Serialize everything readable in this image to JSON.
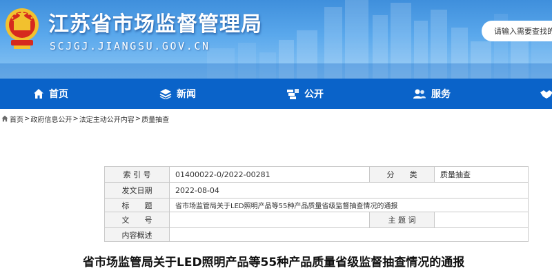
{
  "header": {
    "site_title": "江苏省市场监督管理局",
    "site_domain": "SCJGJ.JIANGSU.GOV.CN",
    "search_placeholder": "请输入需要查找的内容"
  },
  "colors": {
    "nav_background": "#0a63c9",
    "header_sky": "#5aa8ec",
    "label_cell_background": "#f3f3f3",
    "table_border": "#c9c9c9"
  },
  "nav": {
    "items": [
      {
        "label": "首页",
        "icon": "home-icon"
      },
      {
        "label": "新闻",
        "icon": "layers-icon"
      },
      {
        "label": "公开",
        "icon": "stack-icon"
      },
      {
        "label": "服务",
        "icon": "people-icon"
      }
    ]
  },
  "breadcrumb": {
    "icon": "home-icon",
    "items": [
      "首页",
      "政府信息公开",
      "法定主动公开内容",
      "质量抽查"
    ],
    "separator": ">"
  },
  "info_table": {
    "index_label": "索 引 号",
    "index_value": "01400022-0/2022-00281",
    "category_label": "分　　类",
    "category_value": "质量抽查",
    "date_label": "发文日期",
    "date_value": "2022-08-04",
    "title_label": "标　　题",
    "title_value": "省市场监管局关于LED照明产品等55种产品质量省级监督抽查情况的通报",
    "doc_no_label": "文　　号",
    "doc_no_value": "",
    "subject_label": "主 题 词",
    "subject_value": "",
    "summary_label": "内容概述",
    "summary_value": ""
  },
  "article": {
    "title": "省市场监管局关于LED照明产品等55种产品质量省级监督抽查情况的通报"
  }
}
